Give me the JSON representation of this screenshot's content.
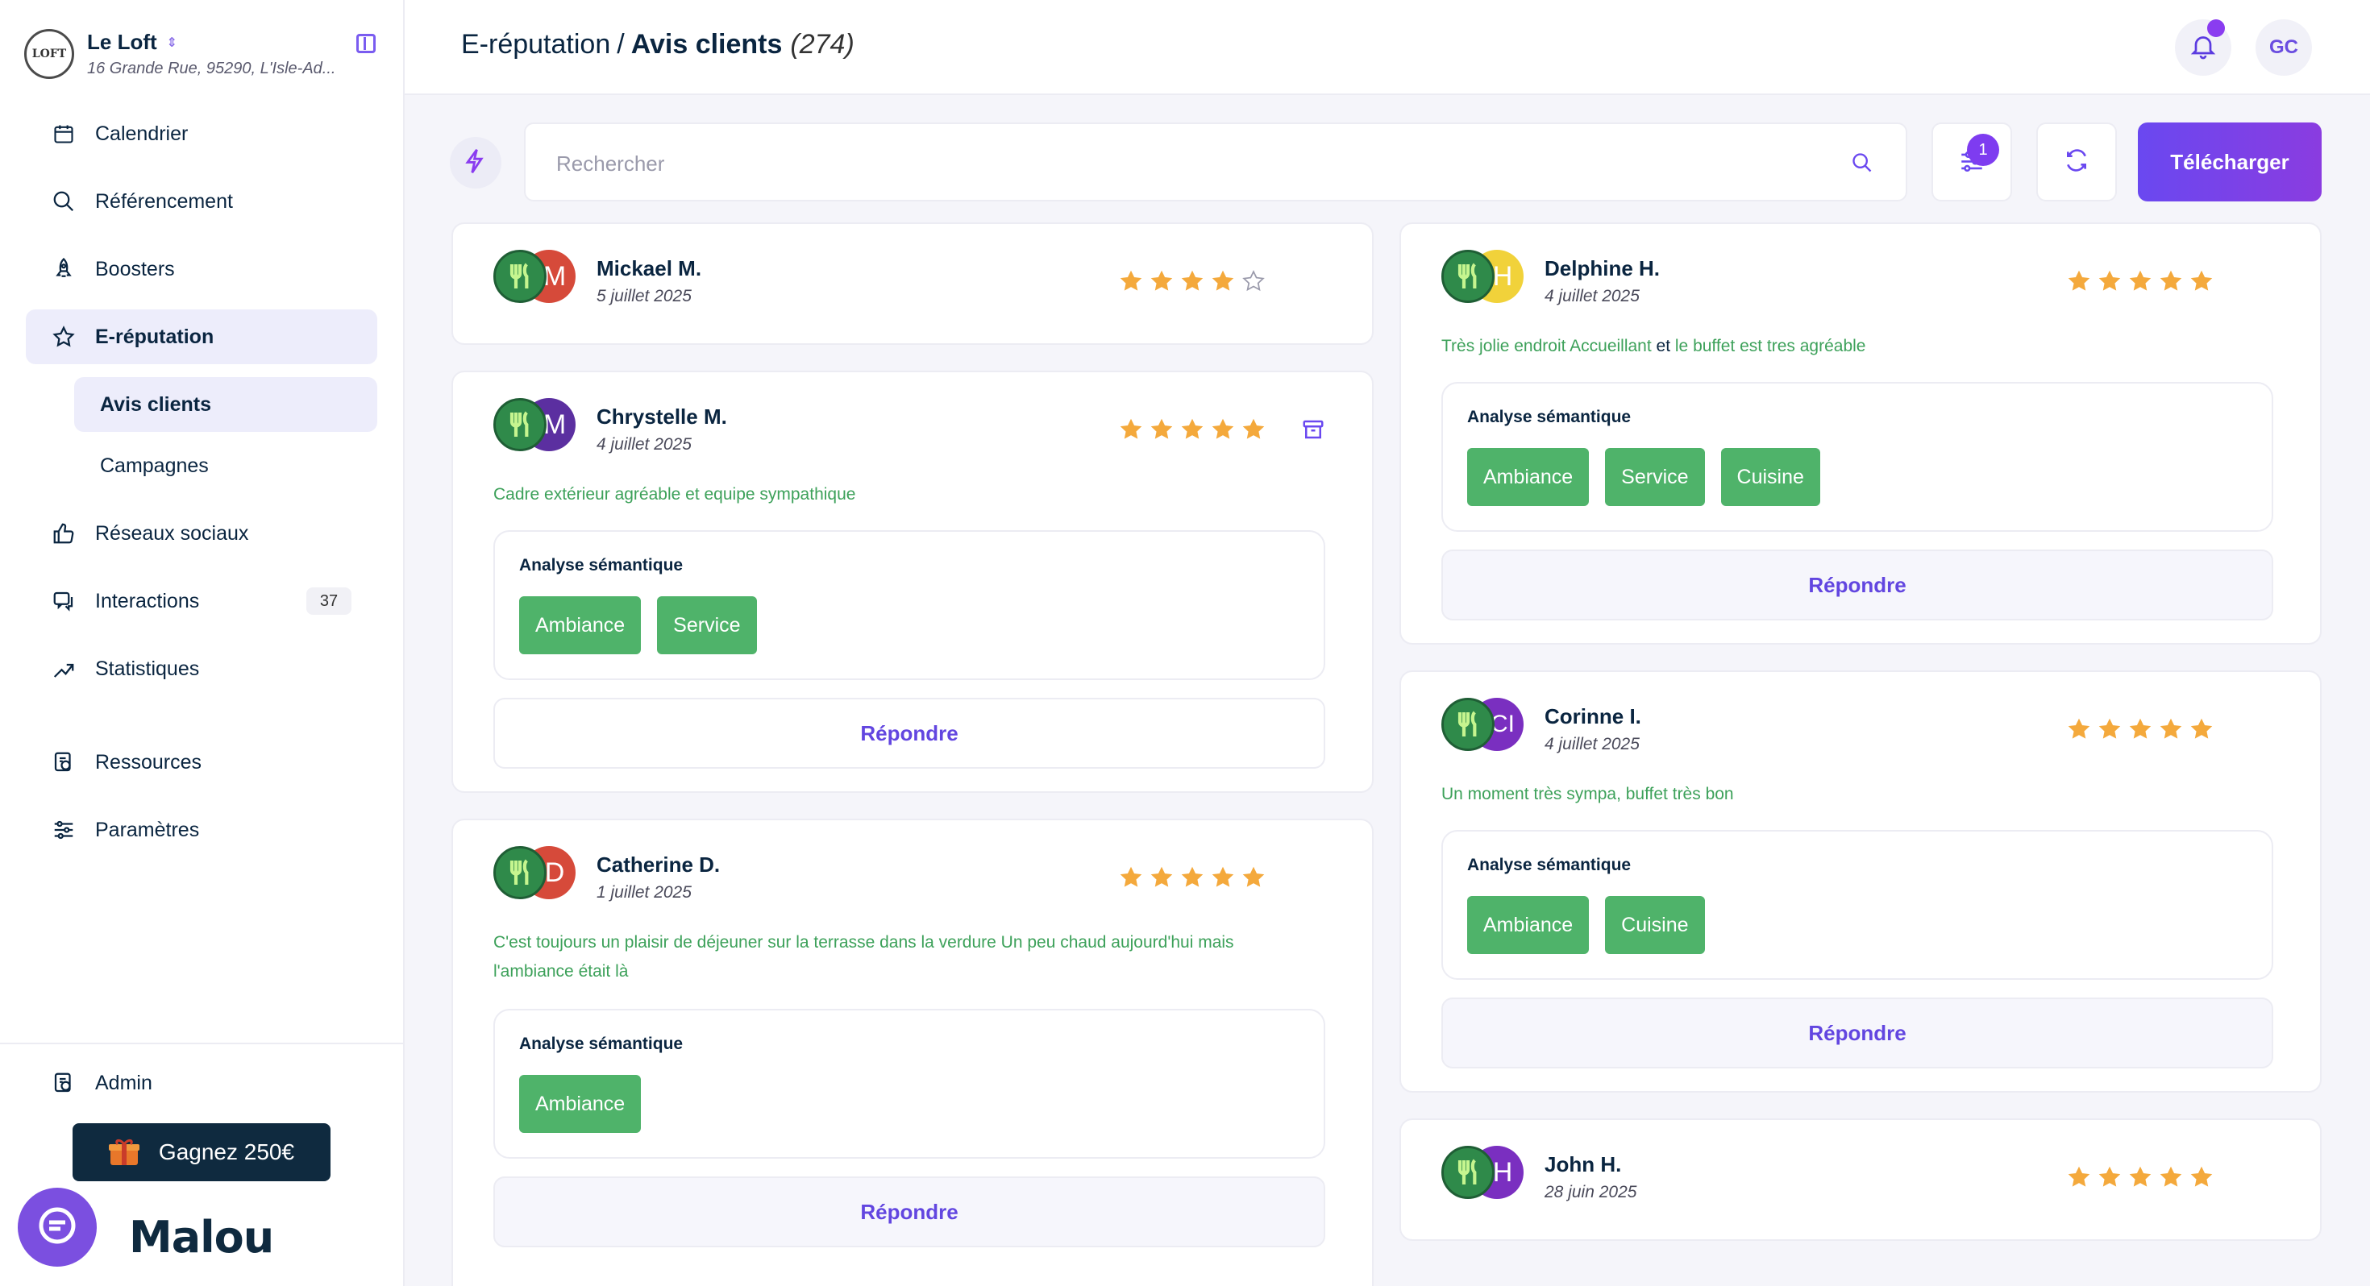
{
  "restaurant": {
    "name": "Le Loft",
    "address": "16 Grande Rue, 95290, L'Isle-Ad...",
    "logo_text": "LOFT"
  },
  "sidebar": {
    "items": [
      {
        "label": "Calendrier",
        "icon": "calendar-icon"
      },
      {
        "label": "Référencement",
        "icon": "search-icon"
      },
      {
        "label": "Boosters",
        "icon": "rocket-icon"
      },
      {
        "label": "E-réputation",
        "icon": "star-icon"
      },
      {
        "label": "Réseaux sociaux",
        "icon": "thumbs-up-icon"
      },
      {
        "label": "Interactions",
        "icon": "chat-icon",
        "count": "37"
      },
      {
        "label": "Statistiques",
        "icon": "trend-icon"
      },
      {
        "label": "Ressources",
        "icon": "resources-icon"
      },
      {
        "label": "Paramètres",
        "icon": "sliders-icon"
      }
    ],
    "sub_items": [
      {
        "label": "Avis clients"
      },
      {
        "label": "Campagnes"
      }
    ],
    "admin_label": "Admin",
    "gift_label": "Gagnez 250€",
    "brand_logo": "Malou"
  },
  "header": {
    "section": "E-réputation",
    "separator": "/",
    "page": "Avis clients",
    "count": "(274)",
    "user_initials": "GC"
  },
  "toolbar": {
    "search_placeholder": "Rechercher",
    "filter_count": "1",
    "download_label": "Télécharger"
  },
  "colors": {
    "accent": "#6a48f0",
    "green_tag": "#4fb36a",
    "star": "#f4a93c"
  },
  "labels": {
    "semantic_title": "Analyse sémantique",
    "reply": "Répondre"
  },
  "reviews": [
    {
      "name": "Mickael M.",
      "date": "5 juillet 2025",
      "rating": 4,
      "initial": "M",
      "text": "",
      "tags": []
    },
    {
      "name": "Chrystelle M.",
      "date": "4 juillet 2025",
      "rating": 5,
      "initial": "M",
      "text": "Cadre extérieur agréable et equipe sympathique",
      "tags": [
        "Ambiance",
        "Service"
      ]
    },
    {
      "name": "Catherine D.",
      "date": "1 juillet 2025",
      "rating": 5,
      "initial": "D",
      "text_line1": "C'est toujours un plaisir de déjeuner sur la terrasse dans la verdure Un peu chaud aujourd'hui mais",
      "text_line2": "l'ambiance était là",
      "tags": [
        "Ambiance"
      ]
    },
    {
      "name": "Delphine H.",
      "date": "4 juillet 2025",
      "rating": 5,
      "initial": "H",
      "text_a": "Très jolie endroit Accueillant",
      "text_b": "et",
      "text_c": "le buffet est tres agréable",
      "tags": [
        "Ambiance",
        "Service",
        "Cuisine"
      ]
    },
    {
      "name": "Corinne I.",
      "date": "4 juillet 2025",
      "rating": 5,
      "initial": "CI",
      "text": "Un moment très sympa, buffet très bon",
      "tags": [
        "Ambiance",
        "Cuisine"
      ]
    },
    {
      "name": "John H.",
      "date": "28 juin 2025",
      "rating": 5,
      "initial": "H",
      "text": "",
      "tags": []
    }
  ]
}
